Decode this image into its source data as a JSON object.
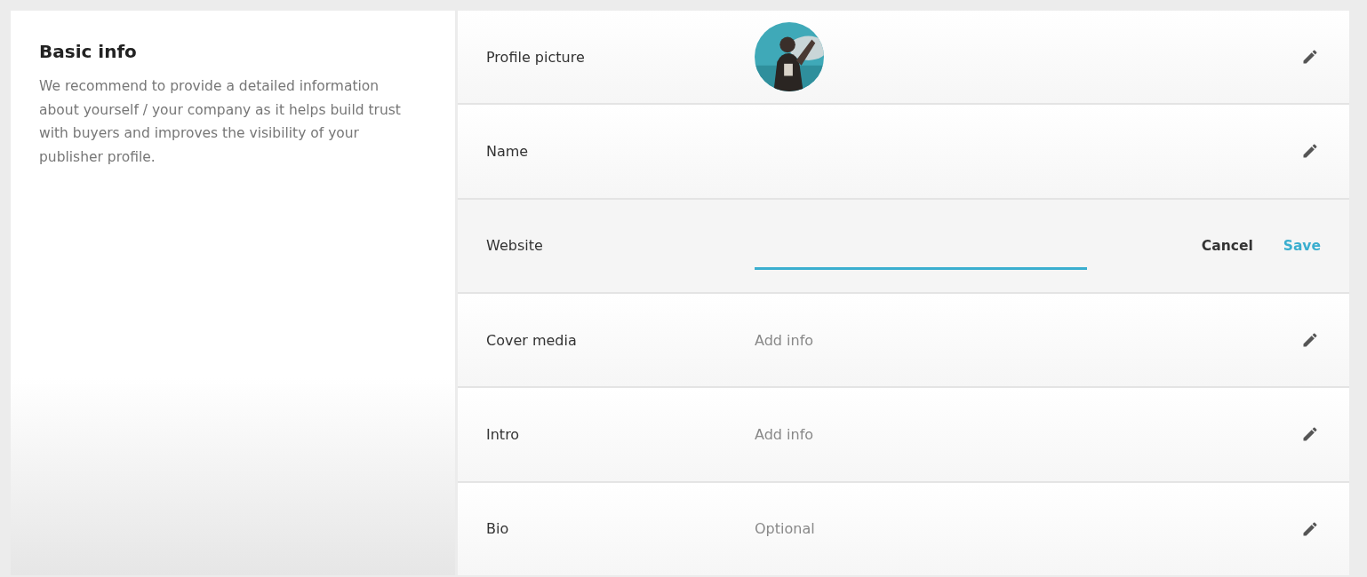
{
  "intro": {
    "title": "Basic info",
    "description": "We recommend to provide a detailed information about yourself / your company as it helps build trust with buyers and improves the visibility of your publisher profile."
  },
  "rows": [
    {
      "label": "Profile picture",
      "kind": "avatar",
      "editing": false
    },
    {
      "label": "Name",
      "kind": "text",
      "editing": false
    },
    {
      "label": "Website",
      "kind": "text",
      "editing": true,
      "actions": [
        "Cancel",
        "Save"
      ]
    },
    {
      "label": "Cover media",
      "kind": "text",
      "editing": false,
      "hint": "Add info"
    },
    {
      "label": "Intro",
      "kind": "text",
      "editing": false,
      "hint": "Add info"
    },
    {
      "label": "Bio",
      "kind": "text",
      "editing": false,
      "hint": "Optional"
    }
  ]
}
